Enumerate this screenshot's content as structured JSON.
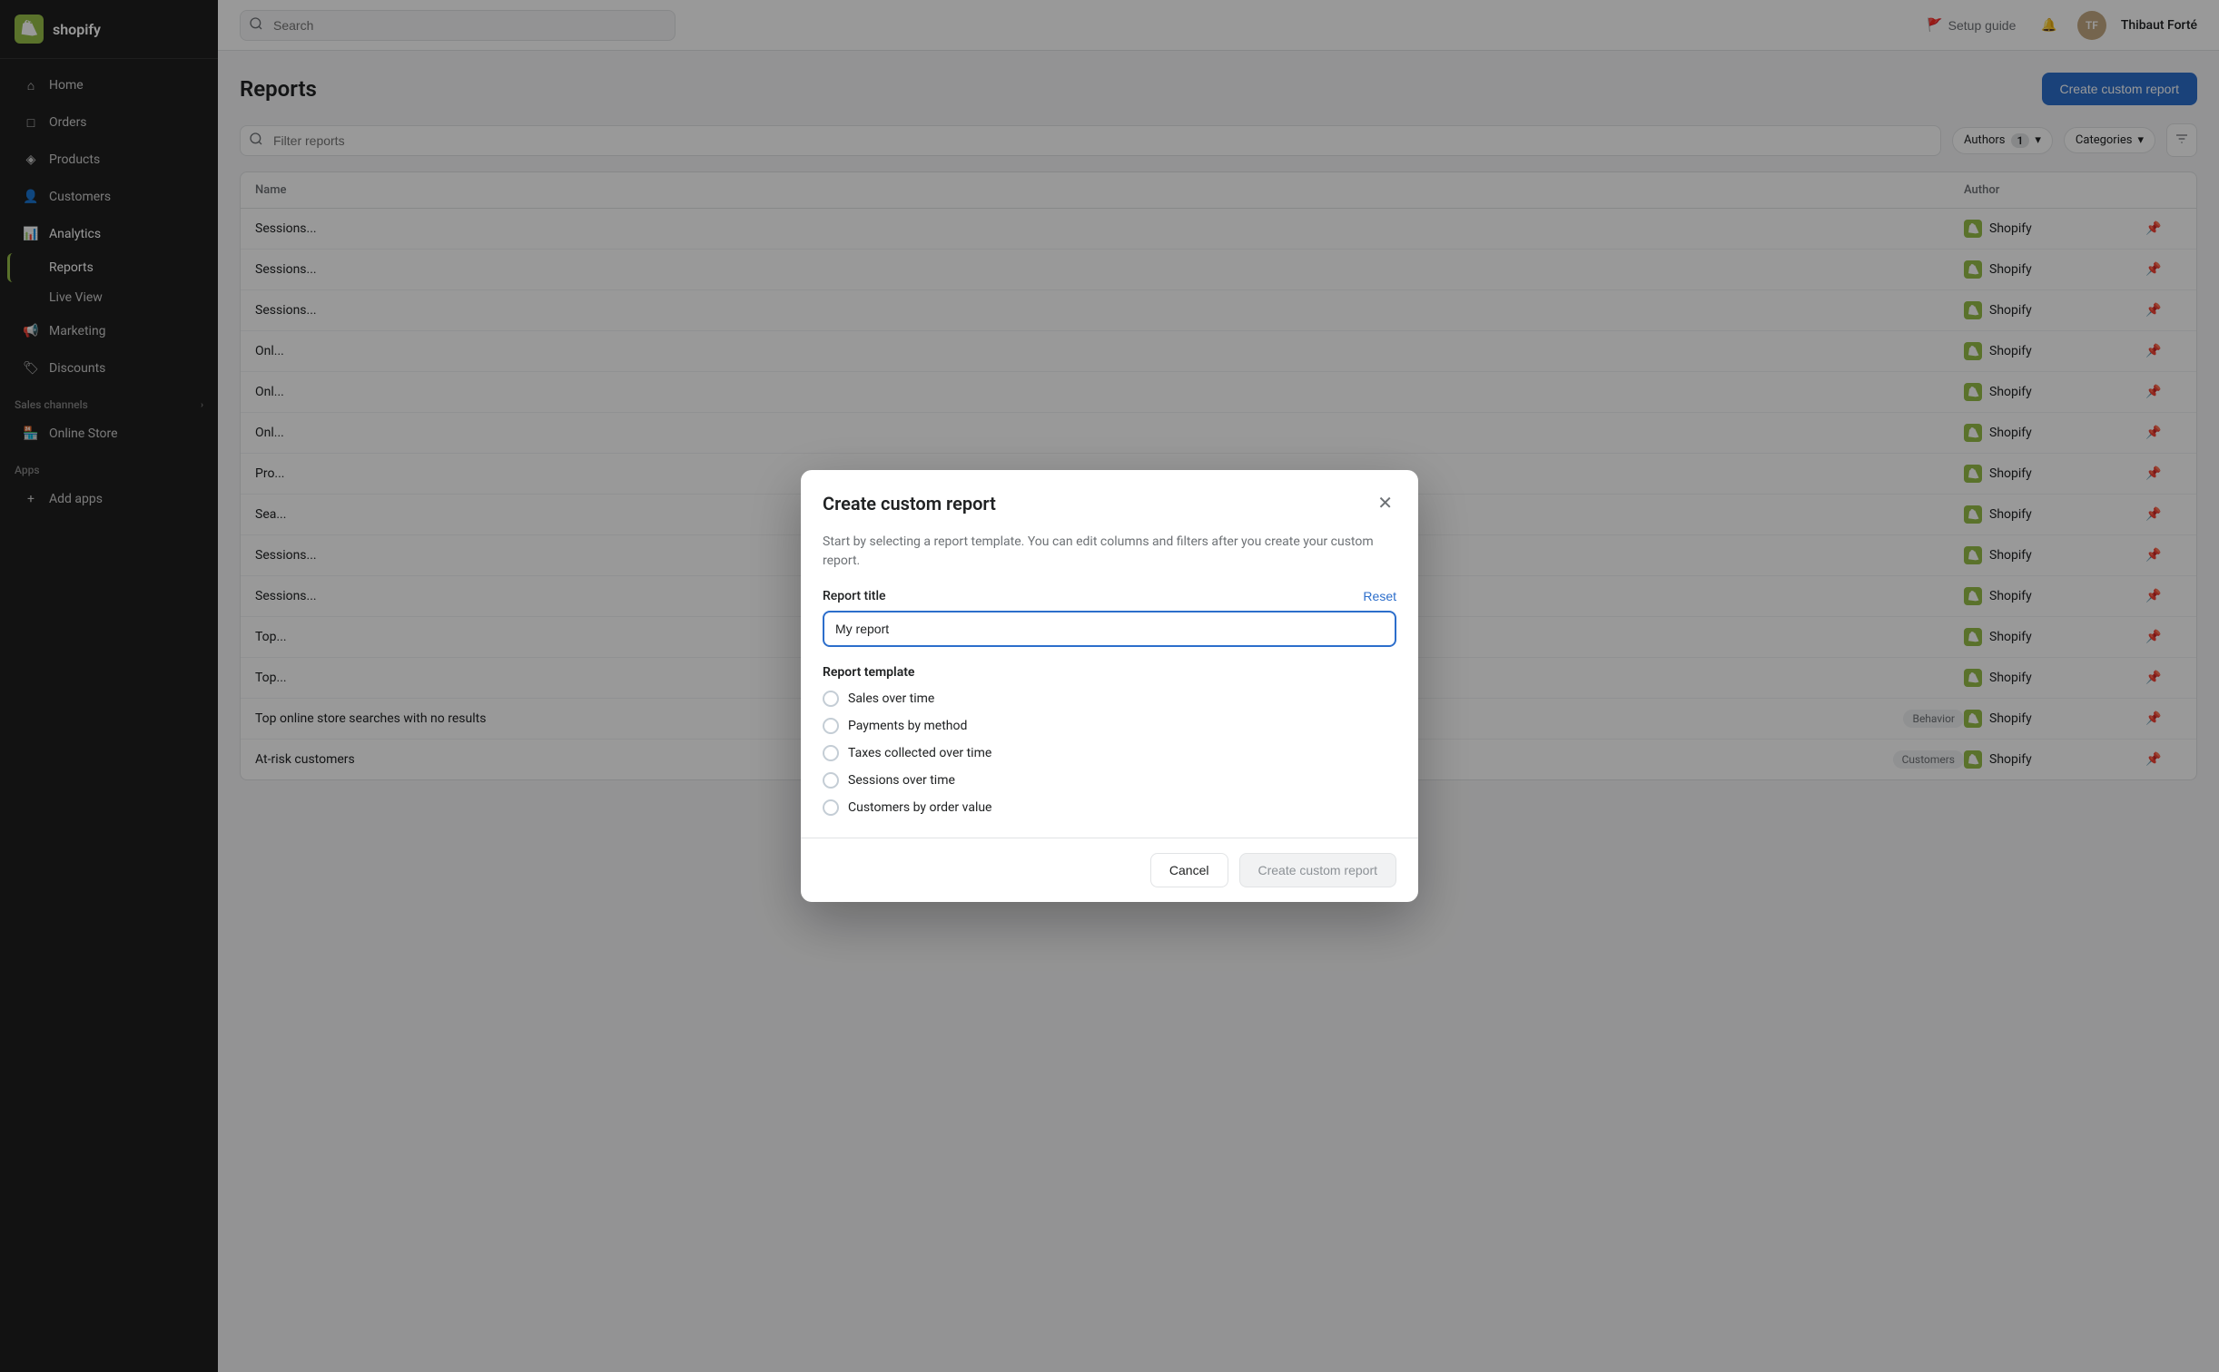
{
  "sidebar": {
    "brand": "shopify",
    "nav_items": [
      {
        "id": "home",
        "label": "Home",
        "icon": "home-icon",
        "active": false
      },
      {
        "id": "orders",
        "label": "Orders",
        "icon": "orders-icon",
        "active": false
      },
      {
        "id": "products",
        "label": "Products",
        "icon": "products-icon",
        "active": false
      },
      {
        "id": "customers",
        "label": "Customers",
        "icon": "customers-icon",
        "active": false
      },
      {
        "id": "analytics",
        "label": "Analytics",
        "icon": "analytics-icon",
        "active": true
      },
      {
        "id": "marketing",
        "label": "Marketing",
        "icon": "marketing-icon",
        "active": false
      },
      {
        "id": "discounts",
        "label": "Discounts",
        "icon": "discounts-icon",
        "active": false
      }
    ],
    "sub_items": [
      {
        "id": "reports",
        "label": "Reports",
        "active": true
      },
      {
        "id": "live-view",
        "label": "Live View",
        "active": false
      }
    ],
    "sales_channels_label": "Sales channels",
    "online_store_label": "Online Store",
    "apps_label": "Apps",
    "add_apps_label": "Add apps"
  },
  "topbar": {
    "search_placeholder": "Search",
    "setup_guide_label": "Setup guide",
    "user_name": "Thibaut Forté"
  },
  "page": {
    "title": "Reports",
    "create_button_label": "Create custom report",
    "filter_placeholder": "Filter reports",
    "authors_filter_label": "Authors",
    "authors_filter_count": "1",
    "categories_filter_label": "Categories",
    "table_columns": {
      "name": "Name",
      "author": "Author"
    },
    "rows": [
      {
        "name": "Sessions...",
        "category": "",
        "author": "Shopify"
      },
      {
        "name": "Sessions...",
        "category": "",
        "author": "Shopify"
      },
      {
        "name": "Sessions...",
        "category": "",
        "author": "Shopify"
      },
      {
        "name": "Onl...",
        "category": "",
        "author": "Shopify"
      },
      {
        "name": "Onl...",
        "category": "",
        "author": "Shopify"
      },
      {
        "name": "Onl...",
        "category": "",
        "author": "Shopify"
      },
      {
        "name": "Pro...",
        "category": "",
        "author": "Shopify"
      },
      {
        "name": "Sea...",
        "category": "",
        "author": "Shopify"
      },
      {
        "name": "Sessions...",
        "category": "",
        "author": "Shopify"
      },
      {
        "name": "Sessions...",
        "category": "",
        "author": "Shopify"
      },
      {
        "name": "Top...",
        "category": "",
        "author": "Shopify"
      },
      {
        "name": "Top...",
        "category": "",
        "author": "Shopify"
      },
      {
        "name": "Top online store searches with no results",
        "category": "Behavior",
        "author": "Shopify"
      },
      {
        "name": "At-risk customers",
        "category": "Customers",
        "author": "Shopify"
      }
    ]
  },
  "modal": {
    "title": "Create custom report",
    "close_icon": "×",
    "description": "Start by selecting a report template. You can edit columns and filters after you create your custom report.",
    "report_title_label": "Report title",
    "reset_label": "Reset",
    "report_title_value": "My report",
    "report_template_label": "Report template",
    "templates": [
      {
        "id": "sales-over-time",
        "label": "Sales over time",
        "selected": false
      },
      {
        "id": "payments-by-method",
        "label": "Payments by method",
        "selected": false
      },
      {
        "id": "taxes-collected-over-time",
        "label": "Taxes collected over time",
        "selected": false
      },
      {
        "id": "sessions-over-time",
        "label": "Sessions over time",
        "selected": false
      },
      {
        "id": "customers-by-order-value",
        "label": "Customers by order value",
        "selected": false
      }
    ],
    "cancel_label": "Cancel",
    "create_label": "Create custom report"
  }
}
